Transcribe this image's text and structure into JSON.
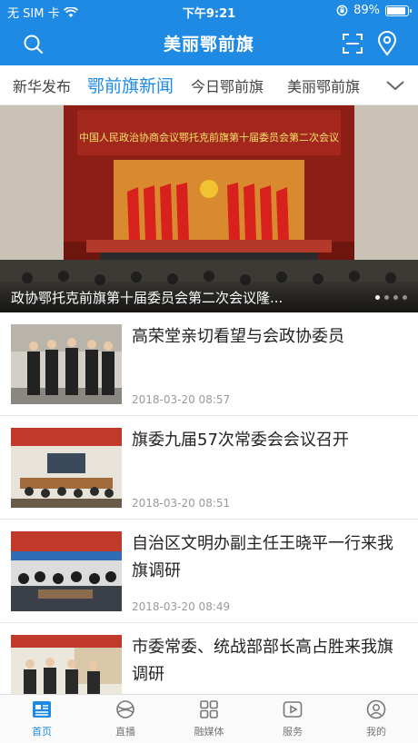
{
  "status_bar": {
    "carrier": "无 SIM 卡",
    "time": "下午9:21",
    "battery": "89%",
    "battery_level": 0.89
  },
  "header": {
    "title": "美丽鄂前旗"
  },
  "tabs": [
    {
      "label": "新华发布"
    },
    {
      "label": "鄂前旗新闻"
    },
    {
      "label": "今日鄂前旗"
    },
    {
      "label": "美丽鄂前旗"
    }
  ],
  "banner": {
    "stage_banner": "中国人民政治协商会议鄂托克前旗第十届委员会第二次会议",
    "caption": "政协鄂托克前旗第十届委员会第二次会议隆..."
  },
  "news": [
    {
      "title": "高荣堂亲切看望与会政协委员",
      "date": "2018-03-20 08:57"
    },
    {
      "title": "旗委九届57次常委会会议召开",
      "date": "2018-03-20 08:51"
    },
    {
      "title": "自治区文明办副主任王晓平一行来我旗调研",
      "date": "2018-03-20 08:49"
    },
    {
      "title": "市委常委、统战部部长高占胜来我旗调研",
      "date": ""
    }
  ],
  "bottom_nav": [
    {
      "label": "首页",
      "icon": "home-icon"
    },
    {
      "label": "直播",
      "icon": "live-icon"
    },
    {
      "label": "融媒体",
      "icon": "grid-icon"
    },
    {
      "label": "服务",
      "icon": "play-icon"
    },
    {
      "label": "我的",
      "icon": "user-icon"
    }
  ],
  "colors": {
    "accent": "#1e8ae3"
  }
}
